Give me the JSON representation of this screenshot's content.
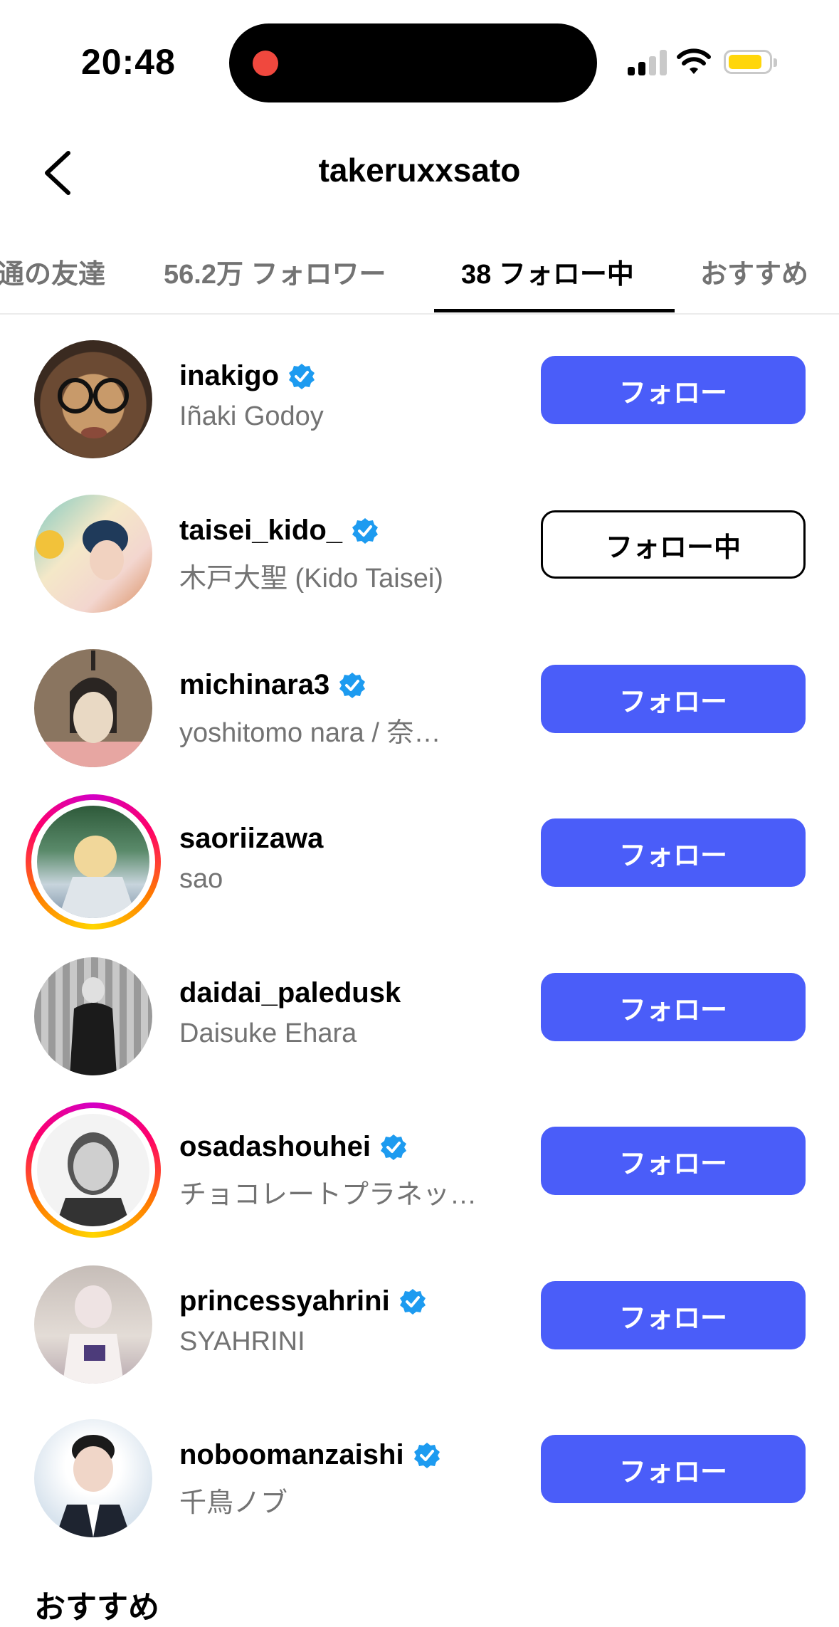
{
  "status_bar": {
    "time": "20:48"
  },
  "header": {
    "title": "takeruxxsato"
  },
  "tabs": [
    {
      "label": "通の友達",
      "active": false
    },
    {
      "label": "56.2万 フォロワー",
      "active": false
    },
    {
      "label": "38 フォロー中",
      "active": true
    },
    {
      "label": "おすすめ",
      "active": false
    }
  ],
  "accounts": [
    {
      "username": "inakigo",
      "name": "Iñaki Godoy",
      "verified": true,
      "story_ring": false,
      "button": "フォロー"
    },
    {
      "username": "taisei_kido_",
      "name": "木戸大聖 (Kido Taisei)",
      "verified": true,
      "story_ring": false,
      "button": "フォロー中"
    },
    {
      "username": "michinara3",
      "name": "yoshitomo nara / 奈…",
      "verified": true,
      "story_ring": false,
      "button": "フォロー"
    },
    {
      "username": "saoriizawa",
      "name": "sao",
      "verified": false,
      "story_ring": true,
      "button": "フォロー"
    },
    {
      "username": "daidai_paledusk",
      "name": "Daisuke Ehara",
      "verified": false,
      "story_ring": false,
      "button": "フォロー"
    },
    {
      "username": "osadashouhei",
      "name": "チョコレートプラネッ…",
      "verified": true,
      "story_ring": true,
      "button": "フォロー"
    },
    {
      "username": "princessyahrini",
      "name": "SYAHRINI",
      "verified": true,
      "story_ring": false,
      "button": "フォロー"
    },
    {
      "username": "noboomanzaishi",
      "name": "千鳥ノブ",
      "verified": true,
      "story_ring": false,
      "button": "フォロー"
    }
  ],
  "section_title": "おすすめ",
  "colors": {
    "follow_button": "#4a5df9",
    "verified_badge": "#1d9bf0",
    "secondary_text": "#737373"
  }
}
